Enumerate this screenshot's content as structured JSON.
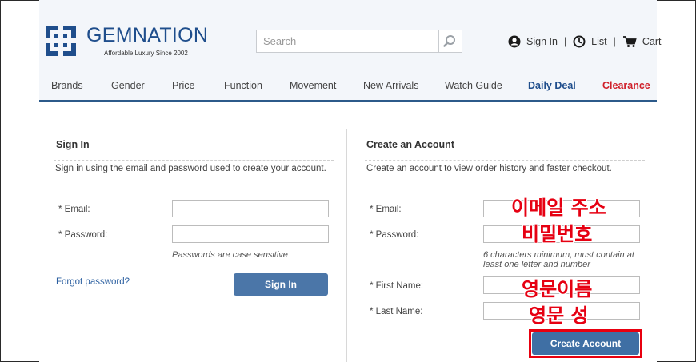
{
  "header": {
    "logo_name": "GEMNATION",
    "logo_tagline": "Affordable Luxury Since 2002",
    "search_placeholder": "Search",
    "sign_in_label": "Sign In",
    "list_label": "List",
    "cart_label": "Cart",
    "separator": "|"
  },
  "nav": {
    "items": [
      "Brands",
      "Gender",
      "Price",
      "Function",
      "Movement",
      "New Arrivals",
      "Watch Guide",
      "Daily Deal",
      "Clearance"
    ]
  },
  "signin": {
    "title": "Sign In",
    "description": "Sign in using the email and password used to create your account.",
    "email_label": "* Email:",
    "password_label": "* Password:",
    "password_hint": "Passwords are case sensitive",
    "forgot_label": "Forgot password?",
    "button_label": "Sign In"
  },
  "create": {
    "title": "Create an Account",
    "description": "Create an account to view order history and faster checkout.",
    "email_label": "* Email:",
    "password_label": "* Password:",
    "password_hint": "6 characters minimum, must contain at least one letter and number",
    "first_name_label": "* First Name:",
    "last_name_label": "* Last Name:",
    "button_label": "Create Account"
  },
  "annotations": {
    "email": "이메일 주소",
    "password": "비밀번호",
    "first_name": "영문이름",
    "last_name": "영문 성"
  },
  "colors": {
    "brand_blue": "#1f4e8c",
    "nav_bar": "#2c5a8a",
    "button": "#4b76a8",
    "clearance": "#d0202a",
    "annotation_red": "#e60012"
  }
}
